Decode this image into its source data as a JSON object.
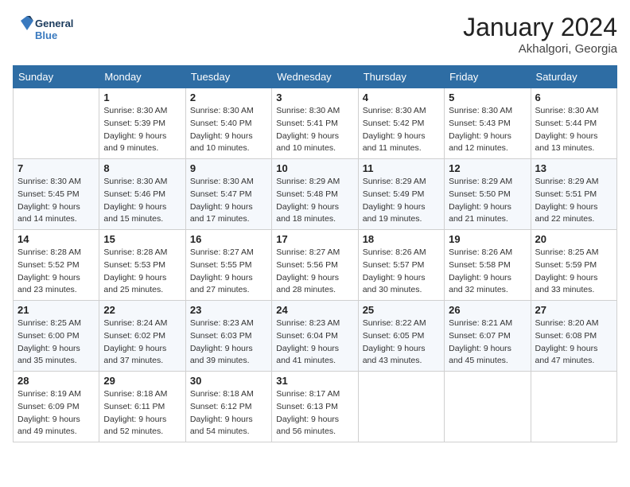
{
  "header": {
    "logo_general": "General",
    "logo_blue": "Blue",
    "month_title": "January 2024",
    "location": "Akhalgori, Georgia"
  },
  "weekdays": [
    "Sunday",
    "Monday",
    "Tuesday",
    "Wednesday",
    "Thursday",
    "Friday",
    "Saturday"
  ],
  "weeks": [
    [
      {
        "day": "",
        "sunrise": "",
        "sunset": "",
        "daylight": ""
      },
      {
        "day": "1",
        "sunrise": "Sunrise: 8:30 AM",
        "sunset": "Sunset: 5:39 PM",
        "daylight": "Daylight: 9 hours and 9 minutes."
      },
      {
        "day": "2",
        "sunrise": "Sunrise: 8:30 AM",
        "sunset": "Sunset: 5:40 PM",
        "daylight": "Daylight: 9 hours and 10 minutes."
      },
      {
        "day": "3",
        "sunrise": "Sunrise: 8:30 AM",
        "sunset": "Sunset: 5:41 PM",
        "daylight": "Daylight: 9 hours and 10 minutes."
      },
      {
        "day": "4",
        "sunrise": "Sunrise: 8:30 AM",
        "sunset": "Sunset: 5:42 PM",
        "daylight": "Daylight: 9 hours and 11 minutes."
      },
      {
        "day": "5",
        "sunrise": "Sunrise: 8:30 AM",
        "sunset": "Sunset: 5:43 PM",
        "daylight": "Daylight: 9 hours and 12 minutes."
      },
      {
        "day": "6",
        "sunrise": "Sunrise: 8:30 AM",
        "sunset": "Sunset: 5:44 PM",
        "daylight": "Daylight: 9 hours and 13 minutes."
      }
    ],
    [
      {
        "day": "7",
        "sunrise": "Sunrise: 8:30 AM",
        "sunset": "Sunset: 5:45 PM",
        "daylight": "Daylight: 9 hours and 14 minutes."
      },
      {
        "day": "8",
        "sunrise": "Sunrise: 8:30 AM",
        "sunset": "Sunset: 5:46 PM",
        "daylight": "Daylight: 9 hours and 15 minutes."
      },
      {
        "day": "9",
        "sunrise": "Sunrise: 8:30 AM",
        "sunset": "Sunset: 5:47 PM",
        "daylight": "Daylight: 9 hours and 17 minutes."
      },
      {
        "day": "10",
        "sunrise": "Sunrise: 8:29 AM",
        "sunset": "Sunset: 5:48 PM",
        "daylight": "Daylight: 9 hours and 18 minutes."
      },
      {
        "day": "11",
        "sunrise": "Sunrise: 8:29 AM",
        "sunset": "Sunset: 5:49 PM",
        "daylight": "Daylight: 9 hours and 19 minutes."
      },
      {
        "day": "12",
        "sunrise": "Sunrise: 8:29 AM",
        "sunset": "Sunset: 5:50 PM",
        "daylight": "Daylight: 9 hours and 21 minutes."
      },
      {
        "day": "13",
        "sunrise": "Sunrise: 8:29 AM",
        "sunset": "Sunset: 5:51 PM",
        "daylight": "Daylight: 9 hours and 22 minutes."
      }
    ],
    [
      {
        "day": "14",
        "sunrise": "Sunrise: 8:28 AM",
        "sunset": "Sunset: 5:52 PM",
        "daylight": "Daylight: 9 hours and 23 minutes."
      },
      {
        "day": "15",
        "sunrise": "Sunrise: 8:28 AM",
        "sunset": "Sunset: 5:53 PM",
        "daylight": "Daylight: 9 hours and 25 minutes."
      },
      {
        "day": "16",
        "sunrise": "Sunrise: 8:27 AM",
        "sunset": "Sunset: 5:55 PM",
        "daylight": "Daylight: 9 hours and 27 minutes."
      },
      {
        "day": "17",
        "sunrise": "Sunrise: 8:27 AM",
        "sunset": "Sunset: 5:56 PM",
        "daylight": "Daylight: 9 hours and 28 minutes."
      },
      {
        "day": "18",
        "sunrise": "Sunrise: 8:26 AM",
        "sunset": "Sunset: 5:57 PM",
        "daylight": "Daylight: 9 hours and 30 minutes."
      },
      {
        "day": "19",
        "sunrise": "Sunrise: 8:26 AM",
        "sunset": "Sunset: 5:58 PM",
        "daylight": "Daylight: 9 hours and 32 minutes."
      },
      {
        "day": "20",
        "sunrise": "Sunrise: 8:25 AM",
        "sunset": "Sunset: 5:59 PM",
        "daylight": "Daylight: 9 hours and 33 minutes."
      }
    ],
    [
      {
        "day": "21",
        "sunrise": "Sunrise: 8:25 AM",
        "sunset": "Sunset: 6:00 PM",
        "daylight": "Daylight: 9 hours and 35 minutes."
      },
      {
        "day": "22",
        "sunrise": "Sunrise: 8:24 AM",
        "sunset": "Sunset: 6:02 PM",
        "daylight": "Daylight: 9 hours and 37 minutes."
      },
      {
        "day": "23",
        "sunrise": "Sunrise: 8:23 AM",
        "sunset": "Sunset: 6:03 PM",
        "daylight": "Daylight: 9 hours and 39 minutes."
      },
      {
        "day": "24",
        "sunrise": "Sunrise: 8:23 AM",
        "sunset": "Sunset: 6:04 PM",
        "daylight": "Daylight: 9 hours and 41 minutes."
      },
      {
        "day": "25",
        "sunrise": "Sunrise: 8:22 AM",
        "sunset": "Sunset: 6:05 PM",
        "daylight": "Daylight: 9 hours and 43 minutes."
      },
      {
        "day": "26",
        "sunrise": "Sunrise: 8:21 AM",
        "sunset": "Sunset: 6:07 PM",
        "daylight": "Daylight: 9 hours and 45 minutes."
      },
      {
        "day": "27",
        "sunrise": "Sunrise: 8:20 AM",
        "sunset": "Sunset: 6:08 PM",
        "daylight": "Daylight: 9 hours and 47 minutes."
      }
    ],
    [
      {
        "day": "28",
        "sunrise": "Sunrise: 8:19 AM",
        "sunset": "Sunset: 6:09 PM",
        "daylight": "Daylight: 9 hours and 49 minutes."
      },
      {
        "day": "29",
        "sunrise": "Sunrise: 8:18 AM",
        "sunset": "Sunset: 6:11 PM",
        "daylight": "Daylight: 9 hours and 52 minutes."
      },
      {
        "day": "30",
        "sunrise": "Sunrise: 8:18 AM",
        "sunset": "Sunset: 6:12 PM",
        "daylight": "Daylight: 9 hours and 54 minutes."
      },
      {
        "day": "31",
        "sunrise": "Sunrise: 8:17 AM",
        "sunset": "Sunset: 6:13 PM",
        "daylight": "Daylight: 9 hours and 56 minutes."
      },
      {
        "day": "",
        "sunrise": "",
        "sunset": "",
        "daylight": ""
      },
      {
        "day": "",
        "sunrise": "",
        "sunset": "",
        "daylight": ""
      },
      {
        "day": "",
        "sunrise": "",
        "sunset": "",
        "daylight": ""
      }
    ]
  ]
}
